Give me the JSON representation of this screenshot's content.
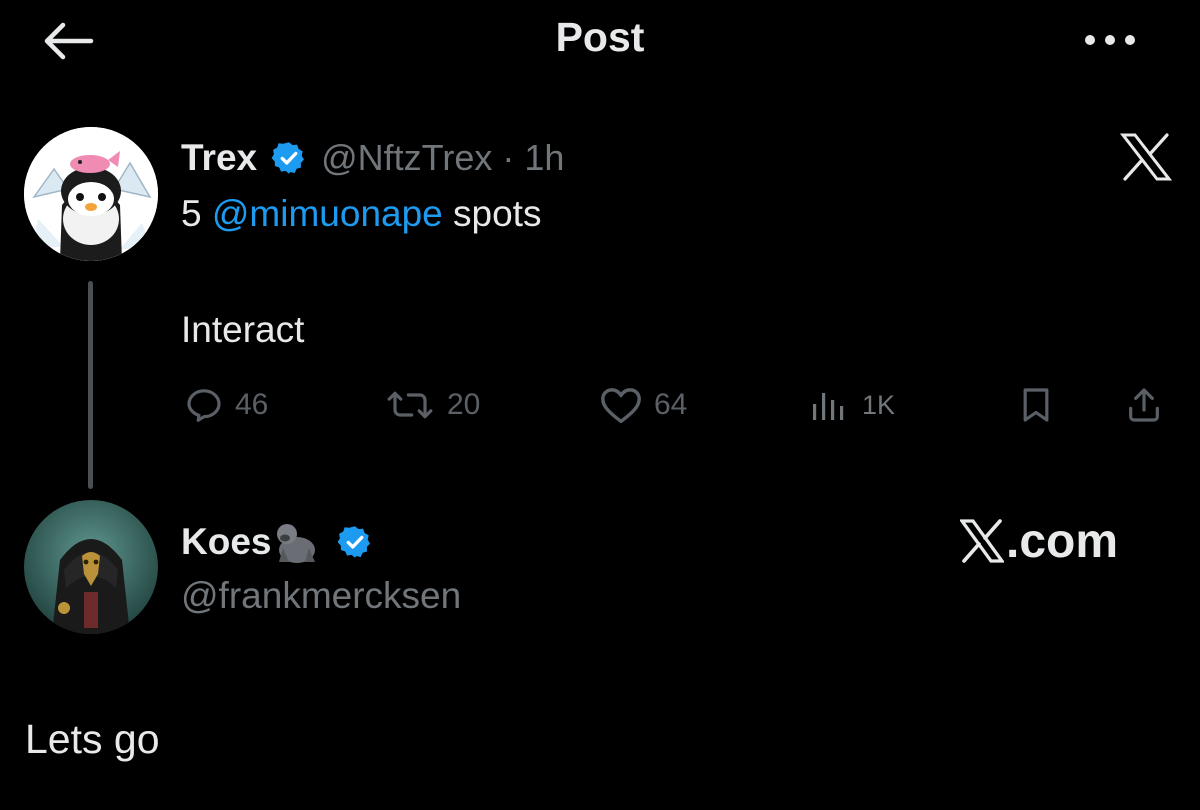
{
  "header": {
    "title": "Post",
    "back_icon": "arrow-left-icon",
    "more_icon": "more-horizontal-icon"
  },
  "parent_post": {
    "author_name": "Trex",
    "handle": "@NftzTrex",
    "time": "· 1h",
    "text_count": "5",
    "mention": "@mimuonape",
    "text_suffix": "spots",
    "text_line2": "Interact",
    "actions": {
      "replies": "46",
      "reposts": "20",
      "likes": "64",
      "views": "1K"
    }
  },
  "reply": {
    "author_name": "Koes",
    "handle": "@frankmercksen",
    "brand": ".com",
    "text": "Lets go"
  },
  "colors": {
    "background": "#000000",
    "text": "#e7e9ea",
    "muted": "#71767b",
    "link": "#1d9bf0",
    "verified": "#1d9bf0"
  }
}
